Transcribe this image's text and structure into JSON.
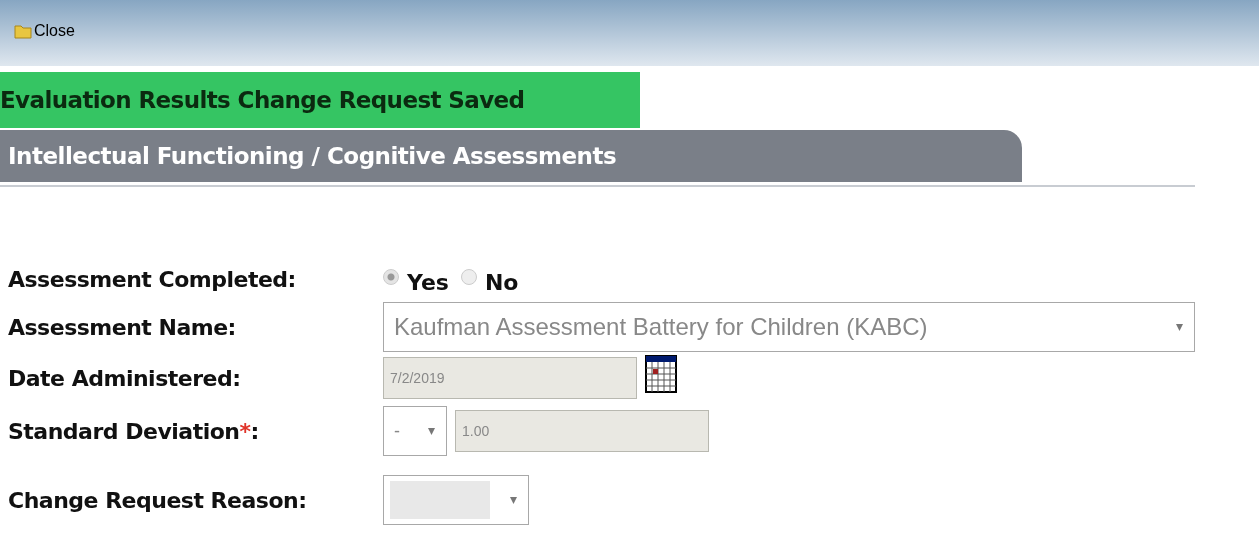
{
  "toolbar": {
    "close_label": "Close"
  },
  "banner": "Evaluation Results Change Request Saved",
  "section_tab": "Intellectual Functioning / Cognitive Assessments",
  "fields": [
    {
      "kind": "radio",
      "label": "Assessment Completed:",
      "options": [
        {
          "label": "Yes",
          "selected": true
        },
        {
          "label": "No",
          "selected": false
        }
      ]
    },
    {
      "kind": "select",
      "label": "Assessment Name:",
      "value": "Kaufman Assessment Battery for Children (KABC)"
    },
    {
      "kind": "date",
      "label": "Date Administered:",
      "value": "7/2/2019"
    },
    {
      "kind": "signed",
      "label": "Standard Deviation",
      "required_mark": "*",
      "label_end": ":",
      "sign": "-",
      "value": "1.00"
    },
    {
      "kind": "blank_select",
      "label": "Change Request Reason:"
    }
  ]
}
